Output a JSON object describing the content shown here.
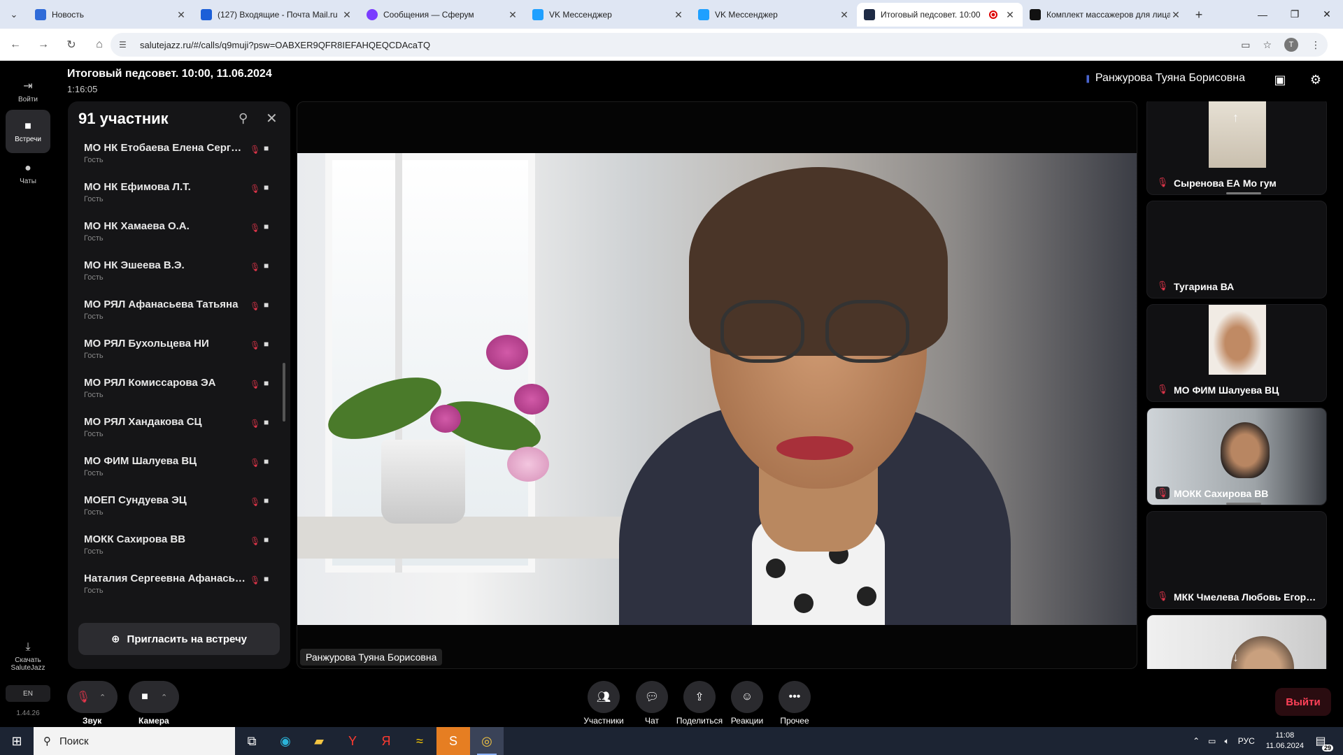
{
  "browser": {
    "tabs": [
      {
        "title": "Новость",
        "color": "#2f6bd8"
      },
      {
        "title": "(127) Входящие - Почта Mail.ru",
        "color": "#1b5fd8"
      },
      {
        "title": "Сообщения — Сферум",
        "color": "#7a3cff"
      },
      {
        "title": "VK Мессенджер",
        "color": "#1fa0ff"
      },
      {
        "title": "VK Мессенджер",
        "color": "#1fa0ff"
      },
      {
        "title": "Итоговый педсовет. 10:00",
        "color": "#1e2b45"
      },
      {
        "title": "Комплект массажеров для лица",
        "color": "#111111"
      }
    ],
    "url": "salutejazz.ru/#/calls/q9muji?psw=OABXER9QFR8IEFAHQEQCDAcaTQ",
    "profile_initial": "T"
  },
  "rail": {
    "login": "Войти",
    "meetings": "Встречи",
    "chats": "Чаты",
    "download": "Скачать SaluteJazz",
    "lang": "EN",
    "version": "1.44.26"
  },
  "meeting": {
    "title": "Итоговый педсовет. 10:00, 11.06.2024",
    "elapsed": "1:16:05",
    "active_speaker": "Ранжурова Туяна Борисовна",
    "main_name_tag": "Ранжурова Туяна Борисовна"
  },
  "participants": {
    "count_label": "91 участник",
    "items": [
      {
        "name": "МО НК Етобаева Елена Сергеевна",
        "role": "Гость"
      },
      {
        "name": "МО НК Ефимова Л.Т.",
        "role": "Гость"
      },
      {
        "name": "МО НК Хамаева О.А.",
        "role": "Гость"
      },
      {
        "name": "МО НК Эшеева В.Э.",
        "role": "Гость"
      },
      {
        "name": "МО РЯЛ Афанасьева Татьяна",
        "role": "Гость"
      },
      {
        "name": "МО РЯЛ Бухольцева НИ",
        "role": "Гость"
      },
      {
        "name": "МО РЯЛ Комиссарова ЭА",
        "role": "Гость"
      },
      {
        "name": "МО РЯЛ Хандакова СЦ",
        "role": "Гость"
      },
      {
        "name": "МО ФИМ Шалуева ВЦ",
        "role": "Гость"
      },
      {
        "name": "МОЕП Сундуева ЭЦ",
        "role": "Гость"
      },
      {
        "name": "МОКК Сахирова ВВ",
        "role": "Гость"
      },
      {
        "name": "Наталия Сергеевна Афанасьева",
        "role": "Гость"
      }
    ],
    "invite_label": "Пригласить на встречу"
  },
  "tiles": [
    {
      "name": "Сыренова ЕА Мо гум"
    },
    {
      "name": "Тугарина ВА"
    },
    {
      "name": "МО ФИМ Шалуева ВЦ"
    },
    {
      "name": "МОКК Сахирова ВВ"
    },
    {
      "name": "МКК Чмелева Любовь Егоровна"
    },
    {
      "name": ""
    }
  ],
  "controls": {
    "sound": "Звук",
    "camera": "Камера",
    "participants": "Участники",
    "chat": "Чат",
    "share": "Поделиться",
    "reactions": "Реакции",
    "more": "Прочее",
    "leave": "Выйти"
  },
  "taskbar": {
    "search_placeholder": "Поиск",
    "lang": "РУС",
    "time": "11:08",
    "date": "11.06.2024",
    "notifications": "29"
  }
}
